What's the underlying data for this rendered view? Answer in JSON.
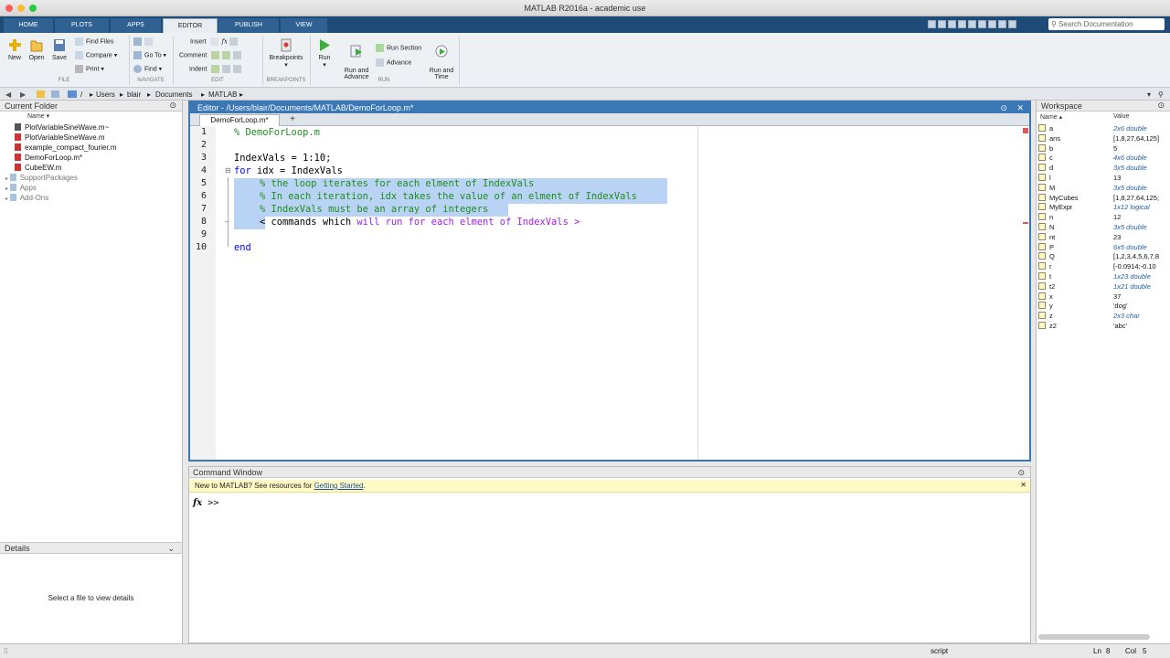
{
  "window_title": "MATLAB R2016a - academic use",
  "tabs": [
    "HOME",
    "PLOTS",
    "APPS",
    "EDITOR",
    "PUBLISH",
    "VIEW"
  ],
  "search_placeholder": "Search Documentation",
  "ribbon": {
    "file": {
      "new": "New",
      "open": "Open",
      "save": "Save",
      "find_files": "Find Files",
      "compare": "Compare",
      "print": "Print",
      "group": "FILE"
    },
    "navigate": {
      "go_to": "Go To",
      "find": "Find",
      "group": "NAVIGATE"
    },
    "edit": {
      "insert": "Insert",
      "comment": "Comment",
      "indent": "Indent",
      "group": "EDIT"
    },
    "breakpoints": {
      "label": "Breakpoints",
      "group": "BREAKPOINTS"
    },
    "run": {
      "run": "Run",
      "run_advance": "Run and\nAdvance",
      "run_section": "Run Section",
      "advance": "Advance",
      "run_time": "Run and\nTime",
      "group": "RUN"
    }
  },
  "address": [
    "/",
    "Users",
    "blair",
    "Documents",
    "MATLAB"
  ],
  "current_folder": {
    "title": "Current Folder",
    "column": "Name ▾",
    "files": [
      "PlotVariableSineWave.m~",
      "PlotVariableSineWave.m",
      "example_compact_fourier.m",
      "DemoForLoop.m*",
      "CubeEW.m"
    ],
    "folders": [
      "SupportPackages",
      "Apps",
      "Add-Ons"
    ]
  },
  "details": {
    "title": "Details",
    "message": "Select a file to view details"
  },
  "editor": {
    "title": "Editor - /Users/blair/Documents/MATLAB/DemoForLoop.m*",
    "tab": "DemoForLoop.m*",
    "line_numbers": [
      "1",
      "2",
      "3",
      "4",
      "5",
      "6",
      "7",
      "8",
      "9",
      "10"
    ],
    "lines": {
      "l1": "% DemoForLoop.m",
      "l3": "IndexVals = 1:10;",
      "l4": "for idx = IndexVals",
      "l5": "% the loop iterates for each elment of IndexVals",
      "l6": "% In each iteration, idx takes the value of an elment of IndexVals",
      "l7": "% IndexVals must be an array of integers",
      "l8a": "< commands which ",
      "l8b": "will run for each elment of IndexVals >",
      "l10": "end"
    }
  },
  "command_window": {
    "title": "Command Window",
    "banner_text": "New to MATLAB? See resources for ",
    "banner_link": "Getting Started",
    "banner_end": ".",
    "fx": "fx",
    "prompt": ">>"
  },
  "workspace": {
    "title": "Workspace",
    "col_name": "Name ▴",
    "col_value": "Value",
    "vars": [
      {
        "name": "a",
        "value": "2x6 double",
        "italic": true
      },
      {
        "name": "ans",
        "value": "[1,8,27,64,125]",
        "italic": false
      },
      {
        "name": "b",
        "value": "5",
        "italic": false
      },
      {
        "name": "c",
        "value": "4x6 double",
        "italic": true
      },
      {
        "name": "d",
        "value": "3x5 double",
        "italic": true
      },
      {
        "name": "l",
        "value": "13",
        "italic": false
      },
      {
        "name": "M",
        "value": "3x5 double",
        "italic": true
      },
      {
        "name": "MyCubes",
        "value": "[1,8,27,64,125;",
        "italic": false
      },
      {
        "name": "MyExpr",
        "value": "1x12 logical",
        "italic": true
      },
      {
        "name": "n",
        "value": "12",
        "italic": false
      },
      {
        "name": "N",
        "value": "3x5 double",
        "italic": true
      },
      {
        "name": "nt",
        "value": "23",
        "italic": false
      },
      {
        "name": "P",
        "value": "6x5 double",
        "italic": true
      },
      {
        "name": "Q",
        "value": "[1,2,3,4,5,6,7,8",
        "italic": false
      },
      {
        "name": "r",
        "value": "[-0.0914;-0.10",
        "italic": false
      },
      {
        "name": "t",
        "value": "1x23 double",
        "italic": true
      },
      {
        "name": "t2",
        "value": "1x21 double",
        "italic": true
      },
      {
        "name": "x",
        "value": "37",
        "italic": false
      },
      {
        "name": "y",
        "value": "'dog'",
        "italic": false
      },
      {
        "name": "z",
        "value": "2x3 char",
        "italic": true
      },
      {
        "name": "z2",
        "value": "'abc'",
        "italic": false
      }
    ]
  },
  "status": {
    "mode": "script",
    "ln_label": "Ln",
    "ln": "8",
    "col_label": "Col",
    "col": "5"
  },
  "colors": {
    "accent": "#3a77b4",
    "tab_bar": "#1e4b77",
    "selection": "#b8d3f3",
    "comment": "#228b22",
    "string": "#a020f0"
  }
}
